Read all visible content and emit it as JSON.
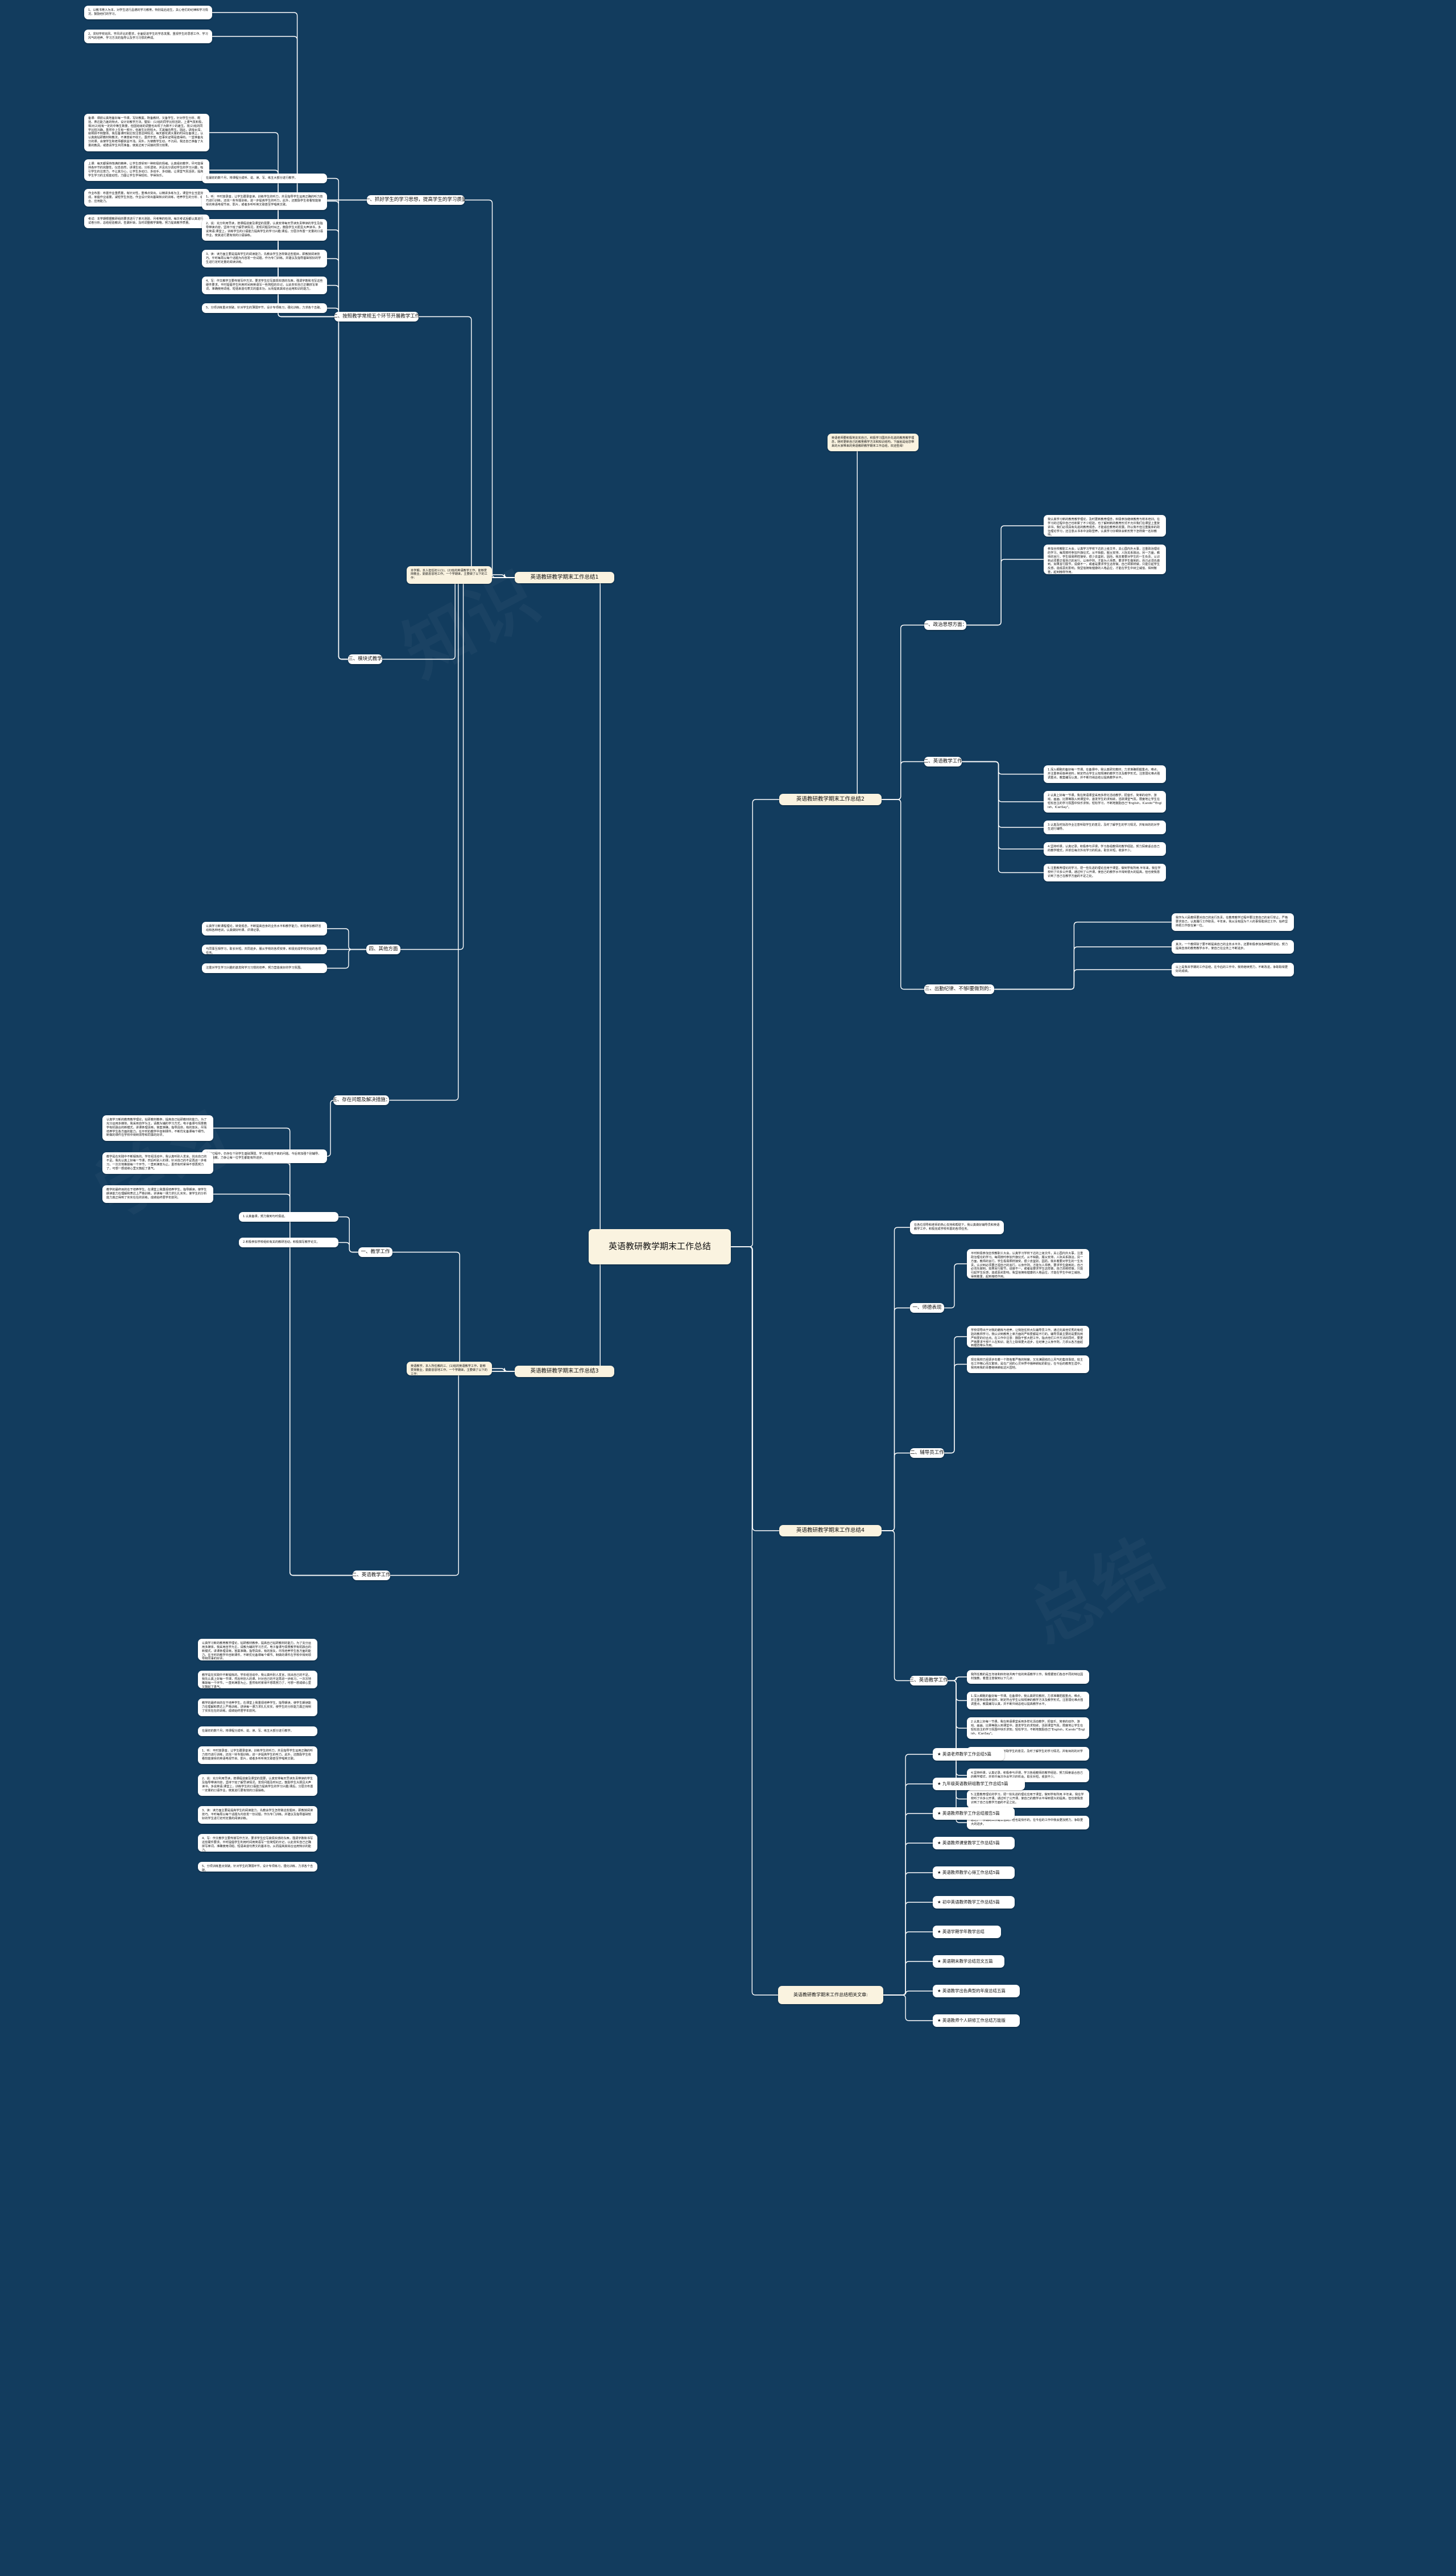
{
  "root": {
    "title": "英语教研教学期末工作总结"
  },
  "branches": [
    {
      "id": "b1",
      "label": "英语教研教学期末工作总结1"
    },
    {
      "id": "b2",
      "label": "英语教研教学期末工作总结2"
    },
    {
      "id": "b3",
      "label": "英语教研教学期末工作总结3"
    },
    {
      "id": "b4",
      "label": "英语教研教学期末工作总结4"
    },
    {
      "id": "b5",
      "label": "英语教研教学期末工作总结相关文章:"
    }
  ],
  "b1": {
    "intro": "本学期，本人担任初三(1)、(2)班的英语教学工作，能够爱岗敬业，勤勤恳恳地工作。一个学期来，主要做了以下的工作：",
    "topics": [
      {
        "label": "一、抓好学生的学习思想，提高学生的学习质量",
        "leaves": [
          "1、以教书育人为本，对学生进行品德的学习教育，特别是后进生，关心他们的纪律和学习情况，鼓励他们的学习。",
          "2、贯彻学校班风、学风评比的要求，全面促进学生的学态发展。重视学生的思想工作、学习风气的培养、学习方法的指导以及学习习惯的养成。"
        ]
      },
      {
        "label": "二、按照教学常规五个环节开展教学工作",
        "leaves": [
          "备课：课前认真地备好每一节课，写好教案。既备教材，又备学生，针对学生分析、概括、表达能力差的特点，设计好教学方法。譬如：(1)班的同学比较活跃，上课气氛积极，相对(2)班有一定的中等生数量，但因班级的调整也出现了为数不少的差生。而(2)班的同学比较沉静，虽然中上生有一部分，但差生比例较大，尤其偏向男生。因此，讲得太深，就照顾不到整体。我在备课时就比较注意这种情况，每天都花费大量的时间在备课上，认认真真钻研教材和教法，不满意就不收工。虽然辛苦，但事实证明是值得的。一堂准备充分的课，会使学生和老师都获益不浅。另外，为使教学生动，不沉闷，我还自己准备了大量的教具，或邀请学生共同准备，使其达到了间接的预习效果。",
          "上课：每天都保持饱满的精神，让学生感受到一种积极的情绪。认真组织教学，尽可能保持各环节的完整性，仪态自然，讲课生动，分析透彻，并且充分调动学生的学习兴趣，吸引学生的注意力，不让其分心，让学生多动口、多动手、多动脑，让课堂气氛活跃，提高学生学习的主观能动性，力图让学生学得轻松、学得快乐。",
          "作业布置：布置作业重质量，有针对性，重难点突出。以精讲多练为主，课堂作业当堂完成，家庭作业适量，减轻学生负担。作业设计突出基础知识的训练，培养学生的分析、综合、应用能力。",
          "考试：本学期根据教研组的要求进行了单元测验、月考等的检测，每次考试后都认真进行试卷分析，总结经验教训，查漏补缺，及时调整教学策略，努力提高教学质量。"
        ]
      },
      {
        "label": "三、模块式教学",
        "leaves": [
          "在最初的数个月，将课程分成听、说、读、写、练五大部分进行教学。",
          "1、听：平时放录音，让学生跟录音读，训练学生的听力，并且指导学生运用正确的听力技巧进行训练，还找一些专题训练，进一步提高学生的听力。此外，还鼓励学生收看较能接受的英语电视节目、影片，或者多听听英文歌甚至学唱英文歌。",
          "2、说：充分利用早读，按课程进度及课堂的需要，认真安排每天早读负责带读的学生及指导带读内容，坚持下班了解早读情况，发现问题及时纠正。鼓励学生大胆且大声读书，多说英语;课堂上，训练学生的口语能力提高学生的学习兴趣;课后，分层次布置一定量的口语作业，使其进行更有效的口语操练。",
          "3、读：读方面主要是提高学生的阅读能力，先教会学生怎样做这些题目，即教授阅读技巧。平时每周以每个话题为内容发一份试题，作为专门训练。并建议及指导基础较好的学生进行定时定量的阅读训练。",
          "4、写：作文教学主要传授写作方法，要求学生应写真情实感的东西，强调字数和书写这些硬件要求。平时提倡学生利用时间用英语写一些简短的日记，以此夯实自己正确拼写单词，准确使用词组、短语来造句表文的基本功，从而提高其综合运用知识的能力。",
          "5、分项训练重点突破。针对学生的薄弱环节，设计专项练习，强化训练，力求各个击破。"
        ]
      },
      {
        "label": "四、其他方面",
        "leaves": [
          "认真学习新课程理论，转变观念，不断提高自身的业务水平和教学能力。积极参加教研活动和各种培训，认真做好听课、评课记录。",
          "与同事互相学习，取长补短，共同进步。服从学校的各项安排，积极完成学校交给的各项任务。",
          "注重对学生学习兴趣的激发和学习习惯的培养，努力营造良好的学习氛围。"
        ]
      },
      {
        "label": "五、存在问题及解决措施：",
        "leaves": [
          "教学过程中，仍存在个别学生基础薄弱、学习积极性不高的问题。今后将加强个别辅导，因材施教，力争让每一位学生都能有所进步。"
        ]
      }
    ]
  },
  "b2": {
    "intro": "英语老师要积极地充实自己，积极学习国内外先进的教育教学理念，随时更新自己的教育教学方法和知识结构，下面就是给您带来的大家带来的英语教研教学期末工作总结，欢迎查阅!",
    "topics": [
      {
        "label": "一、政治思想方面：",
        "leaves": [
          "我认真学习新的教育教学理论，及时更新教育理念，积极参加继续教育与校本培训。在学习的过程中自己也积累了不少经验，也了解到新的教育形式不允许我们在课堂上重复讲书，我们必须具有先进的教育观念，才能适应教育的发展。所以我不但注重集体的政治理论学习，还注意从书本中汲取营养，认真学习仔细体会新形势下怎样做一名好教师。",
          "参加全校教职工大会，认真学习学校下达的上级文件，关心国内外大事，注重政治理论的学习。每周按时参加升旗仪式，从不缺勤。服从安排，人际关系融洽。另一方面，教师的言行，学生极易照样接受，很少去鉴别，因而，我本着要对学生的一生负责，认识到必须要正视自己的言行。以身作则，才能为人师表。要求学生做到的，自己必须先做到。如果言行脱节，说做不一，或者是要求学生这样做，自己却那样做，只能引起学生反感，造成恶劣影响。我坚信拥有健康的人格品位，才能在学生中树立威信、得到敬重，起到榜样作用。"
        ]
      },
      {
        "label": "二、英语教学工作",
        "leaves": [
          "1.深入细致的备好每一节课。在备课中，我认真研究教材，力求准确把握重点，难点，并注重参阅各种资料，制定符合学生认知规律的教学方法及教学形式。注意弱化难点强调重点。教案编写认真，并不断归纳总结以提高教学水平。",
          "2.认真上好每一节课。我在英语课堂采用多样化活动教学，把音乐、简单的动作、游戏、画画、比赛等融入到课堂中，激发学生的求知欲，活跃课堂气氛，限度地让学生在轻松自主的学习氛围中快乐求知，轻松学习，不断地鼓励自己\"English，ICando\"\"English，ICanSay\"。",
          "3.认真及时批改作业注意听取学生的意见，及时了解学生的学习情况，并有目的的对学生进行辅导。",
          "4.坚持听课，认真记录，积极参与评课，学习各组教师的教学经验，努力探索适合自己的教学模式，并抓住每次外出学习的机会，取长补短，收获不少。",
          "5.注重教育理论的学习，把一些先进的理论应用于课堂，做到学有所用.半年来，我在学校听了许多公开课。通过听了公开课，使自己的教学水平得到很大的提高，但也使我意识到了自己在教学方面的不足之处。"
        ]
      },
      {
        "label": "三、出勤纪律、不够l要做到的：",
        "leaves": [
          "我作为人民教师要对自己的言行负责，在教育教学过程中要注意自己的言行举止，严格要求自己，认真履行工作职责。半年来，我从没有因为个人的事情耽误过工作，始终坚持把工作放在第一位。",
          "其次，一个教师除了要不断提高自己的业务水平外，还要积极参加各种教研活动，努力提高自身的教育教学水平，使自己在业务上不断进步。",
          "以上是我本学期的工作总结，在今后的工作中，我将继续努力，不断改进，争取取得更好的成绩。"
        ]
      }
    ]
  },
  "b3": {
    "intro": "英语教学，本人所任教的三、(1)班的英语教学工作，能够爱岗敬业，勤勤恳恳地工作，一个学期来，主要做了以下的工作：",
    "topics": [
      {
        "label": "一、教学工作",
        "leaves": [
          "1.认真备课，努力做到与时俱进。",
          "2.积极参加学校组织有关的教研活动，积极撰写教学论文。"
        ]
      },
      {
        "label": "二、英语教学工作",
        "leaves": [
          "认真学习新的教育教学理论，钻研教材教参，提高自己钻研教材的能力。为了充分运用多媒体，我采用自学为主，请教为辅的学习方式，电子备课与情景教学有机融合的新模式，讲课条理清晰，答案准确，指导具体，有的放矢，尽而培养学生各方面的能力。在平时的教学中自制课件，不断优化备课每个细节。制做的课件在学校中得到领导和同事的好评。",
          "教学是在实践中不断锻炼的。学年组活动中，我认真听别人发言，找出自己的不足。我先认真上好每一节课，然后听别人的课，针对自己的不足再进一步练习，一次次地推敲每一个环节，一直到满意为止。虽然有时累得不想再努力了，可想一想成绩心里又鼓起了勇气。",
          "教学的最终目的在于培养学生。在课堂上我重视培养学生。指导朗读，使学生朗读能力在理解和表达上严格训练，讲读每一课力求扎扎实实，使学生的分析能力真正得到了实实在在的训练。成绩始终居学年前列。"
        ]
      }
    ]
  },
  "b4": {
    "intro": "在各位领导和老师的热心支持和帮助下，我认真做好辅导员和英语教学工作，积极完成学校布置的各项任务。",
    "topics": [
      {
        "label": "一、师德表现",
        "leaves": [
          "平时积极参加全校教职工大会，认真学习学校下达的上级文件，关心国内外大事，注重政治理论的学习。每周按时参加升旗仪式，从不缺勤。服从安排，人际关系融洽。另一方面，教师的言行，学生极易照样接受，很少去鉴别，因而，我本着要对学生的一生负责，认识到必须要正视自己的言行。以身作则，才能为人师表。要求学生做到的，自己必须先做到。如果言行脱节，说做不一，或者是要求学生这样做，自己却那样做，只能引起学生反感，造成恶劣影响。我坚信拥有健康的人格品位，才能在学生中树立威信、得到敬重，起到榜样作用。"
        ]
      },
      {
        "label": "二、辅导员工作",
        "leaves": [
          "学校领导出于对我的磨炼与培养，让我担任校大队辅导员工作。通过向其他优秀的有经验的教师学习，我认识到教育上单方面的严和爱都是不行的。辅导员最主要的是要找到严和爱的切合点。在工作中注意：鼓励干部大胆工作，指点他们工作方法的同时，要更严格要求干部个人在知识、能力上取得更大进步，在纪律上以身作则，力求从各方面起到模范带头作用。",
          "现在我校已经逐步向着一个既有着严格的制度，又充满团结向上风气的集体靠拢。班主任工作精心而又繁琐，是在广阔的心灵世界中播种耕耘的职业，在今后的教育生涯中，我将用我的青春继续耕耘这片园地。"
        ]
      },
      {
        "label": "三、英语教学工作",
        "leaves": [
          "我所任教的是五年级和四年级共两个班的英语教学工作。我根据他们各自不同的特征因材施教，着重注意做到以下几点：",
          "1.深入细致的备好每一节课。在备课中，我认真研究教材，力求准确把握重点，难点，并注重参阅各种资料，制定符合学生认知规律的教学方法及教学形式。注意弱化难点强调重点。教案编写认真，并不断归纳总结以提高教学水平。",
          "2.认真上好每一节课。我在英语课堂采用多样化活动教学，把音乐、简单的动作、游戏、画画、比赛等融入到课堂中，激发学生的求知欲，活跃课堂气氛，限度地让学生在轻松自主的学习氛围中快乐求知，轻松学习，不断地鼓励自己\"English，ICando\"\"English，ICanSay\"。",
          "3.认真及时批改作业注意听取学生的意见，及时了解学生的学习情况，并有目的的对学生进行辅导。",
          "4.坚持听课，认真记录，积极参与评课，学习各组教师的教学经验，努力探索适合自己的教学模式，并抓住每次外出学习的机会，取长补短，收获不少。",
          "5.注重教育理论的学习，把一些先进的理论应用于课堂，做到学有所用.半年来，我在学校听了许多公开课。通过听了公开课，使自己的教学水平得到很大的提高，但也使我意识到了自己在教学方面的不足之处。",
          "总之，一学期的工作是辛苦的，但也是快乐的。在今后的工作中我会更加努力，争取更大的进步。"
        ]
      }
    ]
  },
  "b5": {
    "items": [
      "★ 英语老师教学工作总结5篇",
      "★ 九年级英语教研组教学工作总结5篇",
      "★ 英语教师教学工作总结报告5篇",
      "★ 英语教师课堂教学工作总结5篇",
      "★ 英语教师教学心得工作总结5篇",
      "★ 初中英语教师教学工作总结5篇",
      "★ 英语学期学年教学总结",
      "★ 英语期末教学总结范文五篇",
      "★ 英语教学出色典型的年度总结五篇",
      "★ 英语教师个人研修工作总结万能版"
    ]
  },
  "colors": {
    "background": "#123C5E",
    "node_cream": "#FAF3E0",
    "node_white": "#FFFFFF",
    "link": "#FFFFFF",
    "text": "#111111"
  }
}
